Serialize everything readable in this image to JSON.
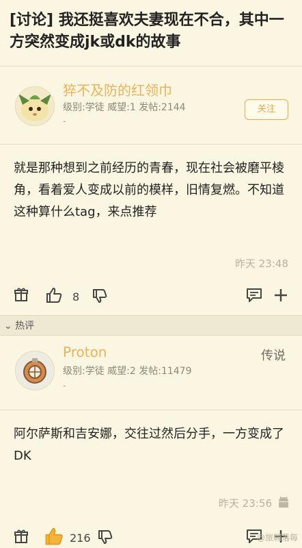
{
  "thread": {
    "title": "[讨论] 我还挺喜欢夫妻现在不合，其中一方突然变成jk或dk的故事"
  },
  "post1": {
    "author": "猝不及防的红领巾",
    "meta": "级别:学徒 威望:1 发帖:2144",
    "dash": "-",
    "follow_label": "关注",
    "content": "就是那种想到之前经历的青春，现在社会被磨平棱角，看着爱人变成以前的模样，旧情复燃。不知道这种算什么tag，来点推荐",
    "time": "昨天 23:48",
    "like_count": "8"
  },
  "hot_section": {
    "label": "⌄ 热评"
  },
  "post2": {
    "author": "Proton",
    "rank": "传说",
    "meta": "级别:学徒 威望:2 发帖:11479",
    "dash": "-",
    "content": "阿尔萨斯和吉安娜，交往过然后分手，一方变成了DK",
    "time": "昨天 23:56",
    "like_count": "216"
  },
  "watermark": "@旅翱落每",
  "colors": {
    "background": "#fbf6e2",
    "author": "#e8b35c",
    "follow_border": "#e3a94f",
    "hot_like": "#f2b53a"
  },
  "icons": [
    "gift-icon",
    "thumb-up-icon",
    "thumb-down-icon",
    "comment-icon",
    "plus-icon",
    "android-icon"
  ]
}
